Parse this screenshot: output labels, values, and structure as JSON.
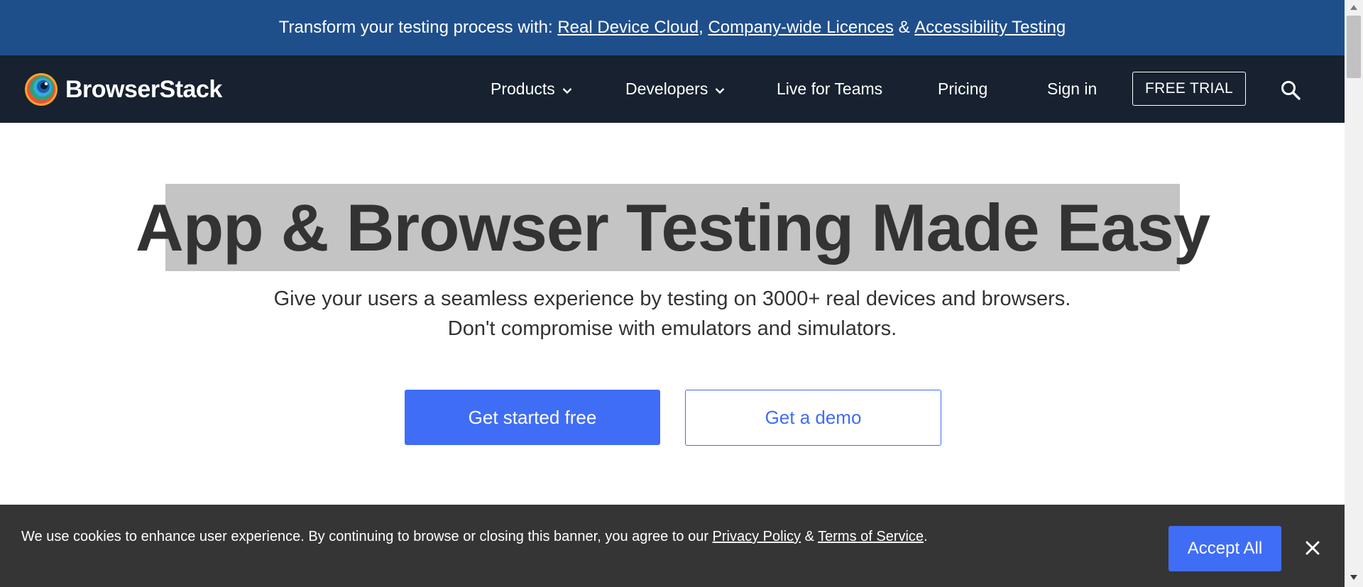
{
  "promo": {
    "prefix": "Transform your testing process with: ",
    "links": [
      "Real Device Cloud",
      "Company-wide Licences",
      "Accessibility Testing"
    ],
    "sep1": ", ",
    "sep2": " & "
  },
  "nav": {
    "brand": "BrowserStack",
    "items": [
      {
        "label": "Products",
        "dropdown": true
      },
      {
        "label": "Developers",
        "dropdown": true
      },
      {
        "label": "Live for Teams",
        "dropdown": false
      },
      {
        "label": "Pricing",
        "dropdown": false
      },
      {
        "label": "Sign in",
        "dropdown": false
      }
    ],
    "trial_label": "FREE TRIAL",
    "search_icon": "search-icon"
  },
  "hero": {
    "title": "App & Browser Testing Made Easy",
    "subtitle_line1": "Give your users a seamless experience by testing on 3000+ real devices and browsers.",
    "subtitle_line2": "Don't compromise with emulators and simulators.",
    "primary_cta": "Get started free",
    "secondary_cta": "Get a demo"
  },
  "cookie": {
    "text": "We use cookies to enhance user experience. By continuing to browse or closing this banner, you agree to our ",
    "privacy_link": "Privacy Policy",
    "amp": " & ",
    "terms_link": "Terms of Service",
    "period": ".",
    "accept_label": "Accept All",
    "close_icon": "close-icon"
  },
  "colors": {
    "promo_bg": "#1f4f8b",
    "nav_bg": "#17212f",
    "accent": "#3f6df5",
    "cookie_bg": "#353535",
    "title_highlight": "#c4c4c4"
  }
}
